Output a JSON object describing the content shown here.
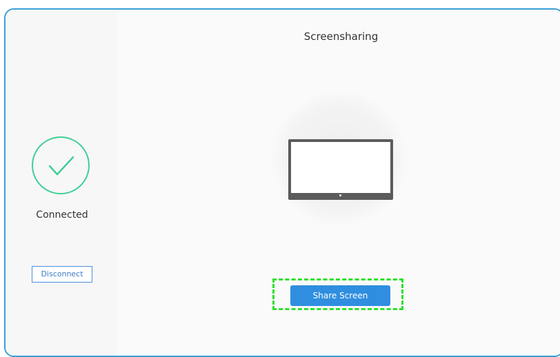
{
  "window": {
    "title": "Screensharing"
  },
  "sidebar": {
    "status_label": "Connected",
    "disconnect_label": "Disconnect",
    "status_icon": "check-icon"
  },
  "main": {
    "monitor_icon": "monitor-icon",
    "share_label": "Share Screen"
  },
  "colors": {
    "accent": "#2f8ee0",
    "success": "#3fcf96",
    "border": "#3aa0d8",
    "highlight": "#2ee02e"
  }
}
